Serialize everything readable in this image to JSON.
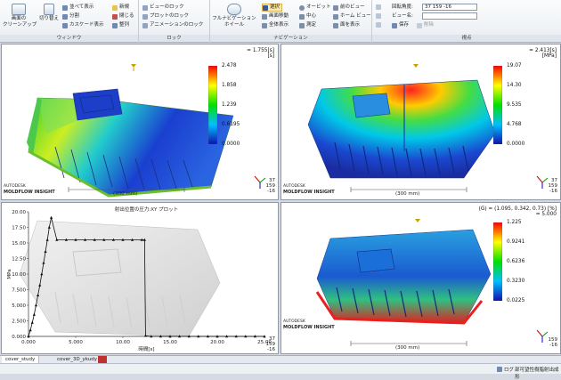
{
  "ribbon": {
    "window": {
      "label": "ウィンドウ",
      "cleanup": "画面の\nクリーンアップ",
      "switch": "切り替え",
      "items": [
        "並べて表示",
        "分割",
        "カスケード表示"
      ],
      "items2": [
        "新規",
        "閉じる",
        "整列"
      ]
    },
    "lock": {
      "label": "ロック",
      "items": [
        "ビューのロック",
        "プロットのロック",
        "アニメーションのロック"
      ]
    },
    "navigation": {
      "label": "ナビゲーション",
      "wheel": "フルナビゲーション\nホイール",
      "col1": [
        "選択",
        "画面移動",
        "全体表示"
      ],
      "col2": [
        "オービット",
        "中心",
        "測定"
      ],
      "col3": [
        "前のビュー",
        "ホーム ビュー",
        "面を表示"
      ]
    },
    "viewpoint": {
      "label": "視点",
      "rotation_label": "回転角度:",
      "rotation_value": "37 159 -16",
      "view_label": "ビュー名:",
      "save": "保存",
      "delete": "削除"
    }
  },
  "panes": [
    {
      "header": "= 1.755[s]\n[s]",
      "legend": [
        "2.478",
        "1.858",
        "1.239",
        "0.6195",
        "0.0000"
      ],
      "colors": [
        "#ff0000",
        "#ffff00",
        "#00e000",
        "#00c0ff",
        "#1010b0"
      ],
      "logo": "AUTODESK",
      "logo_product": "MOLDFLOW INSIGHT",
      "scale": "(300 mm)",
      "coords": [
        "37",
        "159",
        "-16"
      ]
    },
    {
      "header": "= 2.413[s]\n[MPa]",
      "legend": [
        "19.07",
        "14.30",
        "9.535",
        "4.768",
        "0.0000"
      ],
      "colors": [
        "#ff0000",
        "#ffff00",
        "#00e000",
        "#00c0ff",
        "#1010b0"
      ],
      "logo": "AUTODESK",
      "logo_product": "MOLDFLOW INSIGHT",
      "scale": "(300 mm)",
      "coords": [
        "37",
        "159",
        "-16"
      ]
    },
    {
      "logo": "AUTODESK",
      "logo_product": "MOLDFLOW INSIGHT",
      "coords": [
        "37",
        "159",
        "-16"
      ]
    },
    {
      "header": "(G) = (1.095, 0.342, 0.73) [%]\n= 5.000",
      "legend": [
        "1.225",
        "0.9241",
        "0.6236",
        "0.3230",
        "0.0225"
      ],
      "colors": [
        "#ff0000",
        "#ffff00",
        "#00e000",
        "#00c0ff",
        "#1010b0"
      ],
      "logo": "AUTODESK",
      "logo_product": "MOLDFLOW INSIGHT",
      "scale": "(300 mm)",
      "coords": [
        "159",
        "-16"
      ]
    }
  ],
  "chart_data": {
    "type": "line",
    "title": "射出位置の圧力:XY プロット",
    "xlabel": "時間[s]",
    "ylabel": "MPa",
    "xlim": [
      0,
      25
    ],
    "ylim": [
      0,
      20
    ],
    "xticks": [
      "0.000",
      "5.000",
      "10.00",
      "15.00",
      "20.00",
      "25.00"
    ],
    "yticks": [
      "0.000",
      "2.500",
      "5.000",
      "7.500",
      "10.00",
      "12.50",
      "15.00",
      "17.50",
      "20.00"
    ],
    "series": [
      {
        "x": [
          0,
          0.2,
          0.4,
          0.6,
          0.8,
          1.0,
          1.2,
          1.4,
          1.6,
          1.8,
          2.0,
          2.2,
          2.413,
          3,
          4,
          5,
          6,
          7,
          8,
          9,
          10,
          11,
          12,
          12.3,
          12.4,
          13,
          14,
          15,
          16,
          17,
          18,
          19,
          20,
          21,
          22,
          23,
          24,
          25
        ],
        "y": [
          0,
          1,
          2.2,
          3.5,
          5,
          6.6,
          8.2,
          10,
          11.8,
          13.6,
          15.5,
          17.5,
          19.07,
          15.5,
          15.5,
          15.5,
          15.5,
          15.5,
          15.5,
          15.5,
          15.5,
          15.5,
          15.5,
          15.5,
          0.1,
          0,
          0,
          0,
          0,
          0,
          0,
          0,
          0,
          0,
          0,
          0,
          0,
          0
        ]
      }
    ]
  },
  "tabs": [
    "cover_study",
    "cover_3D_ykudy"
  ],
  "status": {
    "log": "ログ",
    "text": "部可望性樹脂射出成形"
  }
}
